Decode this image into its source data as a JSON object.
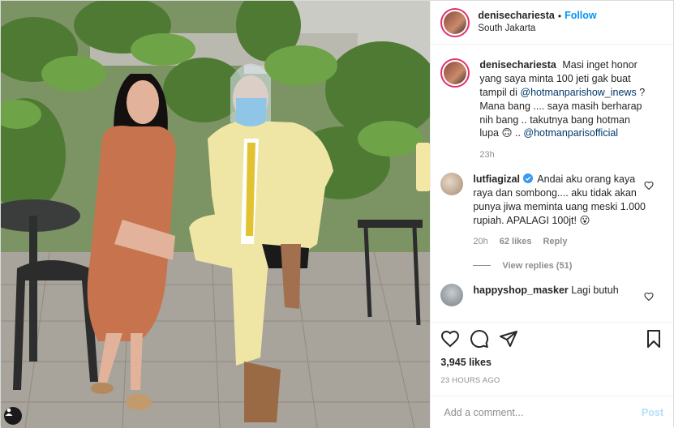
{
  "header": {
    "username": "denisechariesta",
    "separator": "•",
    "follow_label": "Follow",
    "location": "South Jakarta"
  },
  "caption": {
    "username": "denisechariesta",
    "text_1": "Masi inget honor yang saya minta 100 jeti gak buat tampil di ",
    "mention_1": "@hotmanparishow_inews",
    "text_2": " ? Mana bang .... saya masih berharap nih bang .. takutnya bang hotman lupa 🙃 .. ",
    "mention_2": "@hotmanparisofficial",
    "time": "23h"
  },
  "comments": [
    {
      "username": "lutfiagizal",
      "verified": true,
      "text": "Andai aku orang kaya raya dan sombong.... aku tidak akan punya jiwa meminta uang meski 1.000 rupiah. APALAGI 100jt! 😮",
      "time": "20h",
      "likes": "62 likes",
      "reply": "Reply",
      "view_replies": "View replies (51)"
    },
    {
      "username": "happyshop_masker",
      "verified": false,
      "text": "Lagi butuh"
    }
  ],
  "actions": {
    "icons": [
      "heart-icon",
      "comment-icon",
      "share-icon",
      "bookmark-icon"
    ]
  },
  "likes": "3,945 likes",
  "posted_ago": "23 HOURS AGO",
  "add_comment": {
    "placeholder": "Add a comment...",
    "post_label": "Post"
  }
}
